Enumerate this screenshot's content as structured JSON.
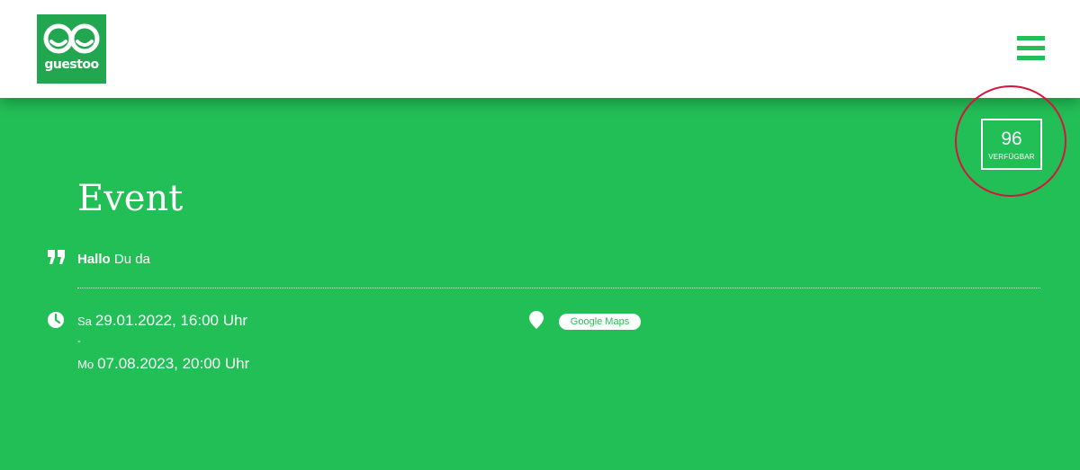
{
  "header": {
    "logo_text": "guestoo",
    "menu_icon": "hamburger-menu-icon"
  },
  "availability": {
    "count": "96",
    "label": "VERFÜGBAR",
    "highlight_color": "#d4163c"
  },
  "event": {
    "title": "Event",
    "description_bold": "Hallo",
    "description_rest": " Du da",
    "start_dow": "Sa",
    "start_datetime": "29.01.2022, 16:00 Uhr",
    "separator": "-",
    "end_dow": "Mo",
    "end_datetime": "07.08.2023, 20:00 Uhr",
    "maps_label": "Google Maps"
  },
  "colors": {
    "brand_green": "#22bf57",
    "logo_green": "#22a650",
    "white": "#ffffff"
  }
}
